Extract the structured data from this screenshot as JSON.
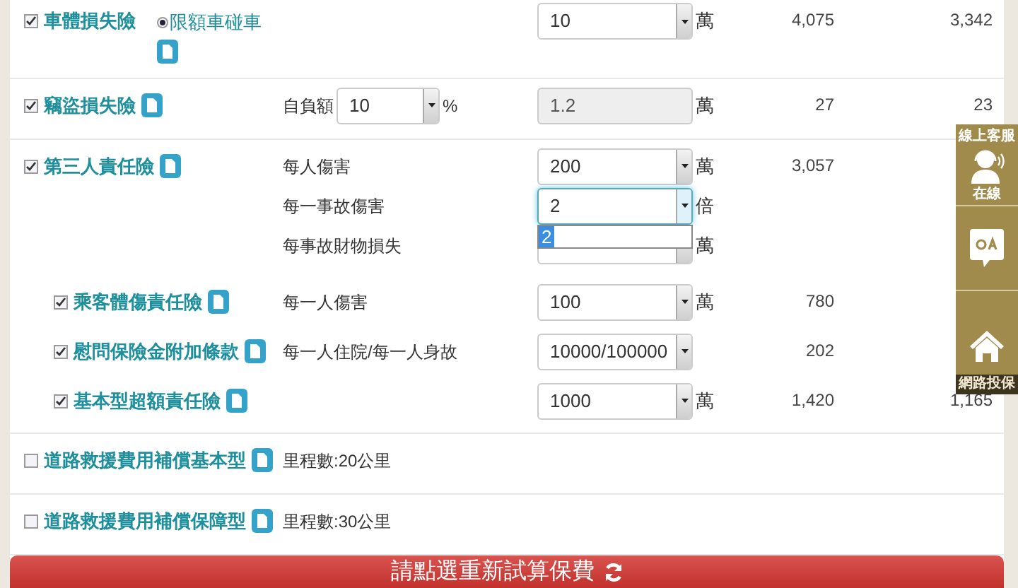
{
  "coverages": [
    {
      "name": "車體損失險",
      "checked": true,
      "option": {
        "label": "限額車碰車",
        "selected": true
      },
      "lines": [
        {
          "field": {
            "kind": "select",
            "value": "10"
          },
          "unit": "萬"
        }
      ],
      "premium_1": "4,075",
      "premium_2": "3,342"
    },
    {
      "name": "竊盜損失險",
      "checked": true,
      "deductible": {
        "label": "自負額",
        "value": "10",
        "unit": "%"
      },
      "lines": [
        {
          "field": {
            "kind": "readonly",
            "value": "1.2"
          },
          "unit": "萬"
        }
      ],
      "premium_1": "27",
      "premium_2": "23"
    },
    {
      "name": "第三人責任險",
      "checked": true,
      "lines": [
        {
          "label": "每人傷害",
          "field": {
            "kind": "select",
            "value": "200"
          },
          "unit": "萬"
        },
        {
          "label": "每一事故傷害",
          "field": {
            "kind": "select",
            "value": "2",
            "focused": true
          },
          "unit": "倍",
          "dropdown_options": [
            {
              "label": "2",
              "selected": true
            }
          ]
        },
        {
          "label": "每事故財物損失",
          "field": {
            "kind": "select"
          },
          "unit": "萬"
        }
      ],
      "premium_1": "3,057",
      "children": [
        {
          "name": "乘客體傷責任險",
          "checked": true,
          "lines": [
            {
              "label": "每一人傷害",
              "field": {
                "kind": "select",
                "value": "100"
              },
              "unit": "萬"
            }
          ],
          "premium_1": "780"
        },
        {
          "name": "慰問保險金附加條款",
          "checked": true,
          "lines": [
            {
              "label": "每一人住院/每一人身故",
              "field": {
                "kind": "select",
                "value": "10000/100000"
              }
            }
          ],
          "premium_1": "202"
        },
        {
          "name": "基本型超額責任險",
          "checked": true,
          "lines": [
            {
              "field": {
                "kind": "select",
                "value": "1000"
              },
              "unit": "萬"
            }
          ],
          "premium_1": "1,420",
          "premium_2": "1,165"
        }
      ]
    },
    {
      "name": "道路救援費用補償基本型",
      "checked": false,
      "lines": [
        {
          "label": "里程數:20公里"
        }
      ]
    },
    {
      "name": "道路救援費用補償保障型",
      "checked": false,
      "lines": [
        {
          "label": "里程數:30公里"
        }
      ]
    }
  ],
  "recalculate_button": "請點選重新試算保費",
  "side_panel": {
    "service_title": "線上客服",
    "service_status": "在線",
    "buy_online": "網路投保"
  }
}
